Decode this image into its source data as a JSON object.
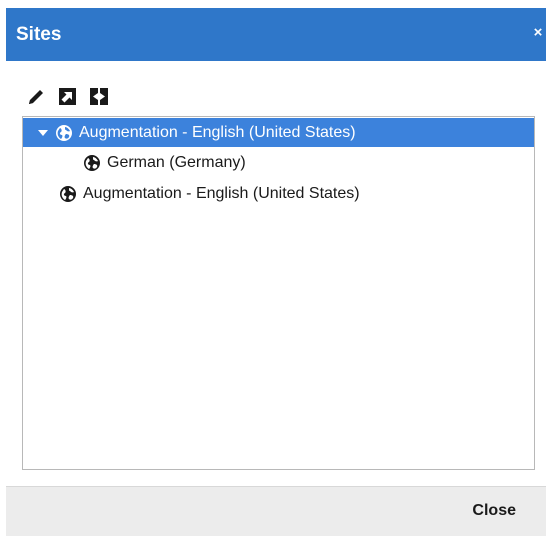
{
  "dialog": {
    "title": "Sites",
    "close_glyph": "×",
    "colors": {
      "titlebar": "#2f77c9",
      "selection": "#3c82dc",
      "footer": "#ececec"
    }
  },
  "toolbar": {
    "tools": [
      {
        "icon": "pencil-icon",
        "name": "edit"
      },
      {
        "icon": "external-link-icon",
        "name": "open"
      },
      {
        "icon": "move-icon",
        "name": "move"
      }
    ]
  },
  "tree": {
    "nodes": [
      {
        "label": "Augmentation - English (United States)",
        "level": 0,
        "expanded": true,
        "selected": true
      },
      {
        "label": "German (Germany)",
        "level": 1,
        "expanded": false,
        "selected": false
      },
      {
        "label": "Augmentation - English (United States)",
        "level": 0,
        "expanded": false,
        "selected": false
      }
    ]
  },
  "footer": {
    "close_label": "Close"
  }
}
